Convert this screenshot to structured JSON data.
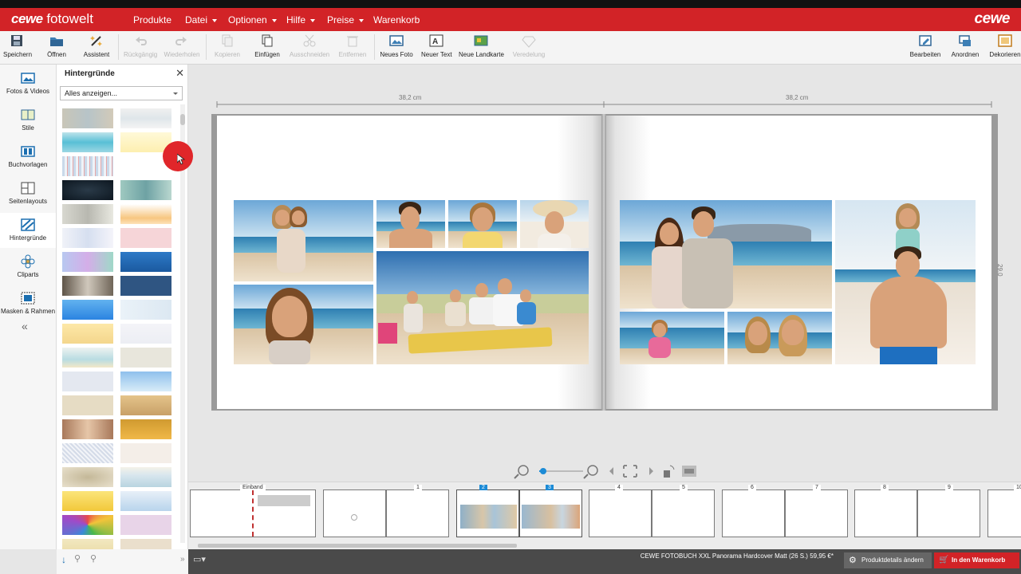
{
  "brand": {
    "left": "cewe",
    "right": "fotowelt",
    "logo": "cewe"
  },
  "menu": [
    {
      "label": "Produkte",
      "caret": false
    },
    {
      "label": "Datei",
      "caret": true
    },
    {
      "label": "Optionen",
      "caret": true
    },
    {
      "label": "Hilfe",
      "caret": true
    },
    {
      "label": "Preise",
      "caret": true
    },
    {
      "label": "Warenkorb",
      "caret": false
    }
  ],
  "toolbar": {
    "save": "Speichern",
    "open": "Öffnen",
    "assistant": "Assistent",
    "undo": "Rückgängig",
    "redo": "Wiederholen",
    "copy": "Kopieren",
    "paste": "Einfügen",
    "cut": "Ausschneiden",
    "remove": "Entfernen",
    "new_photo": "Neues Foto",
    "new_text": "Neuer Text",
    "new_map": "Neue Landkarte",
    "refine": "Veredelung",
    "edit": "Bearbeiten",
    "arrange": "Anordnen",
    "decorate": "Dekorieren"
  },
  "sidebar": [
    {
      "label": "Fotos & Videos",
      "icon": "photo-icon"
    },
    {
      "label": "Stile",
      "icon": "styles-icon"
    },
    {
      "label": "Buchvorlagen",
      "icon": "book-template-icon"
    },
    {
      "label": "Seitenlayouts",
      "icon": "layout-icon"
    },
    {
      "label": "Hintergründe",
      "icon": "background-icon"
    },
    {
      "label": "Cliparts",
      "icon": "clipart-icon"
    },
    {
      "label": "Masken & Rahmen",
      "icon": "mask-icon"
    }
  ],
  "panel": {
    "title": "Hintergründe",
    "filter": "Alles anzeigen..."
  },
  "dimensions": {
    "left": "38,2 cm",
    "right": "38,2 cm",
    "height": "29,0 cm"
  },
  "pages": [
    {
      "label": "Einband",
      "selected": false
    },
    {
      "label": "1",
      "selected": false
    },
    {
      "label": "2",
      "selected": true
    },
    {
      "label": "3",
      "selected": true
    },
    {
      "label": "4",
      "selected": false
    },
    {
      "label": "5",
      "selected": false
    },
    {
      "label": "6",
      "selected": false
    },
    {
      "label": "7",
      "selected": false
    },
    {
      "label": "8",
      "selected": false
    },
    {
      "label": "9",
      "selected": false
    },
    {
      "label": "10",
      "selected": false
    }
  ],
  "status": {
    "product": "CEWE FOTOBUCH XXL Panorama Hardcover Matt (26 S.) 59,95 €*",
    "details_button": "Produktdetails ändern",
    "cart_button": "In den Warenkorb"
  },
  "colors": {
    "brand_red": "#d22327",
    "selection_blue": "#1c8bd6"
  }
}
